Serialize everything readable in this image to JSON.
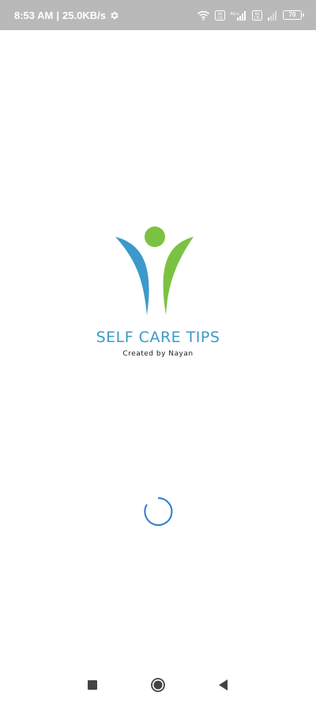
{
  "status_bar": {
    "time": "8:53 AM",
    "separator": "|",
    "speed": "25.0KB/s",
    "battery": "70",
    "icons": [
      "settings-icon",
      "wifi-icon",
      "volte-icon",
      "4g-signal-icon",
      "volte-icon",
      "signal-icon",
      "battery-icon"
    ],
    "network_label": "4G+",
    "volte_label": "Vo LTE"
  },
  "splash": {
    "title": "SELF CARE TIPS",
    "subtitle": "Created by Nayan",
    "colors": {
      "green": "#7cc242",
      "blue": "#3b9ac9"
    }
  },
  "loader": {
    "color": "#2a7bd0"
  },
  "nav_bar": {
    "buttons": [
      "recents-button",
      "home-button",
      "back-button"
    ]
  }
}
